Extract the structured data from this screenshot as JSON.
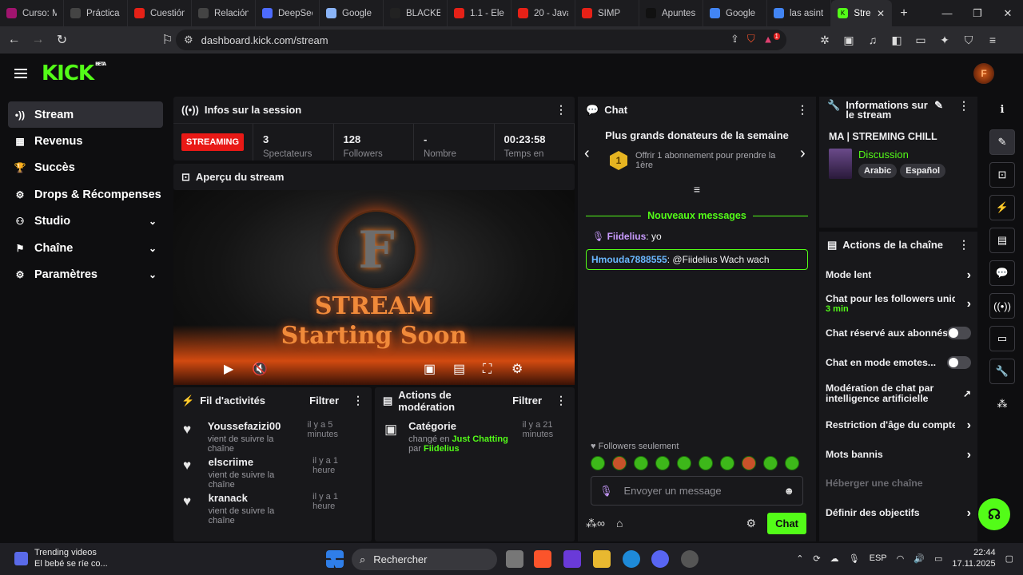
{
  "browser": {
    "tabs": [
      {
        "label": "Curso: M",
        "color": "#a0146e"
      },
      {
        "label": "Práctica",
        "color": "#444"
      },
      {
        "label": "Cuestión",
        "color": "#e62117"
      },
      {
        "label": "Relación",
        "color": "#444"
      },
      {
        "label": "DeepSee",
        "color": "#4d6bfe"
      },
      {
        "label": "Google",
        "color": "#8ab4f8"
      },
      {
        "label": "BLACKB",
        "color": "#222"
      },
      {
        "label": "1.1 - Ele",
        "color": "#e62117"
      },
      {
        "label": "20 - Java",
        "color": "#e62117"
      },
      {
        "label": "SIMP",
        "color": "#e62117"
      },
      {
        "label": "Apuntes",
        "color": "#111"
      },
      {
        "label": "Google",
        "color": "#4285f4"
      },
      {
        "label": "las asint",
        "color": "#4285f4"
      }
    ],
    "active_tab": "Stre",
    "url": "dashboard.kick.com/stream",
    "shield_badge": "",
    "alert_badge": "1"
  },
  "brand": {
    "logo": "KICK",
    "beta": "BETA"
  },
  "sidebar": {
    "items": [
      {
        "label": "Stream",
        "icon": "•))"
      },
      {
        "label": "Revenus",
        "icon": "▦"
      },
      {
        "label": "Succès",
        "icon": "🏆"
      },
      {
        "label": "Drops & Récompenses",
        "icon": "⚙"
      },
      {
        "label": "Studio",
        "icon": "⚇",
        "chev": "⌄"
      },
      {
        "label": "Chaîne",
        "icon": "⚑",
        "chev": "⌄"
      },
      {
        "label": "Paramètres",
        "icon": "⚙",
        "chev": "⌄"
      }
    ]
  },
  "session": {
    "title": "Infos sur la session",
    "status": "STREAMING",
    "stats": [
      {
        "value": "3",
        "label": "Spectateurs"
      },
      {
        "value": "128",
        "label": "Followers"
      },
      {
        "value": "-",
        "label": "Nombre"
      },
      {
        "value": "00:23:58",
        "label": "Temps en"
      }
    ]
  },
  "preview": {
    "title": "Aperçu du stream",
    "line1": "STREAM",
    "line2": "Starting Soon"
  },
  "activity": {
    "title": "Fil d'activités",
    "filter": "Filtrer",
    "items": [
      {
        "name": "Youssefazizi00",
        "sub": "vient de suivre la chaîne",
        "time": "il y a 5 minutes"
      },
      {
        "name": "elscriime",
        "sub": "vient de suivre la chaîne",
        "time": "il y a 1 heure"
      },
      {
        "name": "kranack",
        "sub": "vient de suivre la chaîne",
        "time": "il y a 1 heure"
      }
    ]
  },
  "moderation": {
    "title": "Actions de modération",
    "filter": "Filtrer",
    "item": {
      "name": "Catégorie",
      "time": "il y a 21 minutes",
      "pre": "changé en",
      "cat": "Just Chatting",
      "mid": "par",
      "user": "Fiidelius"
    }
  },
  "chat": {
    "title": "Chat",
    "donors_title": "Plus grands donateurs de la semaine",
    "donor_rank": "1",
    "donor_text": "Offrir 1 abonnement pour prendre la 1ère",
    "new_messages": "Nouveaux messages",
    "messages": [
      {
        "user": "Fiidelius",
        "text": "yo"
      },
      {
        "user": "Hmouda7888555",
        "text": "@Fiidelius Wach wach"
      }
    ],
    "followers_only": "Followers seulement",
    "placeholder": "Envoyer un message",
    "send": "Chat"
  },
  "stream_info": {
    "title": "Informations sur le stream",
    "stream_title": "MA | STREMING CHILL",
    "category": "Discussion",
    "tags": [
      "Arabic",
      "Español"
    ]
  },
  "channel_actions": {
    "title": "Actions de la chaîne",
    "items": [
      {
        "label": "Mode lent",
        "type": "arrow"
      },
      {
        "label": "Chat pour les followers uniq",
        "sub": "3 min",
        "type": "arrow"
      },
      {
        "label": "Chat réservé aux abonnés",
        "type": "toggle"
      },
      {
        "label": "Chat en mode emotes...",
        "type": "toggle"
      },
      {
        "label": "Modération de chat par intelligence artificielle",
        "type": "ext"
      },
      {
        "label": "Restriction d'âge du compte",
        "type": "arrow"
      },
      {
        "label": "Mots bannis",
        "type": "arrow"
      },
      {
        "label": "Héberger une chaîne",
        "type": "disabled"
      },
      {
        "label": "Définir des objectifs",
        "type": "arrow"
      }
    ]
  },
  "taskbar": {
    "trend_title": "Trending videos",
    "trend_sub": "El bebé se ríe co...",
    "search": "Rechercher",
    "lang": "ESP",
    "time": "22:44",
    "date": "17.11.2025"
  }
}
